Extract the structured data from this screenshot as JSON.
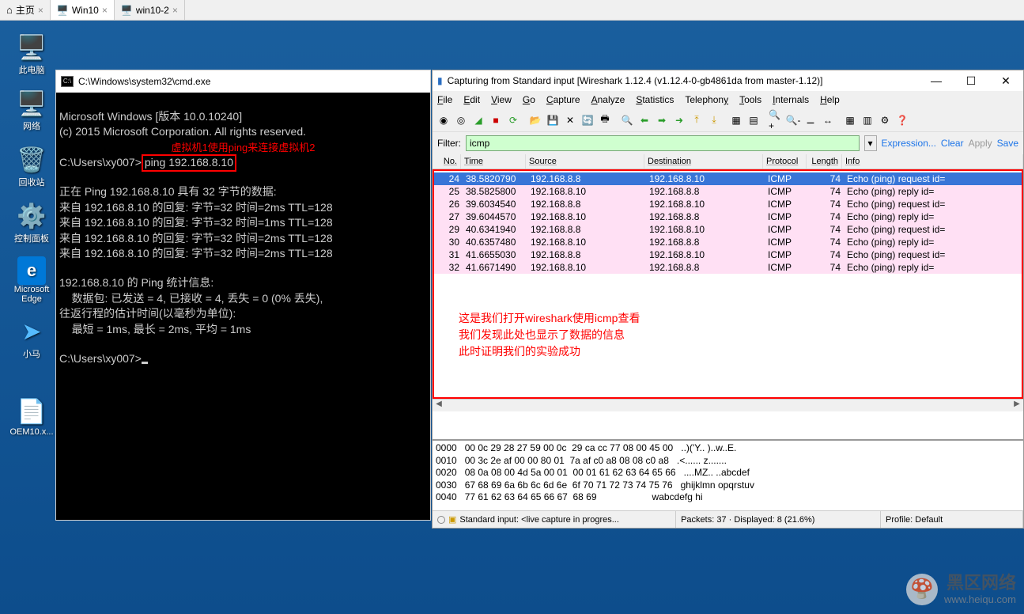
{
  "tabs": {
    "home": "主页",
    "win10": "Win10",
    "win10_2": "win10-2"
  },
  "desktop": [
    {
      "label": "此电脑",
      "icon": "🖥️"
    },
    {
      "label": "网络",
      "icon": "🖥️"
    },
    {
      "label": "回收站",
      "icon": "🗑️"
    },
    {
      "label": "控制面板",
      "icon": "⚙️"
    },
    {
      "label": "Microsoft Edge",
      "icon": "e"
    },
    {
      "label": "小马",
      "icon": "➤"
    },
    {
      "label": "OEM10.x...",
      "icon": "📄"
    }
  ],
  "cmd": {
    "title": "C:\\Windows\\system32\\cmd.exe",
    "line1": "Microsoft Windows [版本 10.0.10240]",
    "line2": "(c) 2015 Microsoft Corporation. All rights reserved.",
    "annotation": "虚拟机1使用ping来连接虚拟机2",
    "prompt1": "C:\\Users\\xy007>",
    "ping_cmd": "ping 192.168.8.10",
    "pinging": "正在 Ping 192.168.8.10 具有 32 字节的数据:",
    "reply1": "来自 192.168.8.10 的回复: 字节=32 时间=2ms TTL=128",
    "reply2": "来自 192.168.8.10 的回复: 字节=32 时间=1ms TTL=128",
    "reply3": "来自 192.168.8.10 的回复: 字节=32 时间=2ms TTL=128",
    "reply4": "来自 192.168.8.10 的回复: 字节=32 时间=2ms TTL=128",
    "stats_hdr": "192.168.8.10 的 Ping 统计信息:",
    "stats_pkts": "    数据包: 已发送 = 4, 已接收 = 4, 丢失 = 0 (0% 丢失),",
    "rtt_hdr": "往返行程的估计时间(以毫秒为单位):",
    "rtt": "    最短 = 1ms, 最长 = 2ms, 平均 = 1ms",
    "prompt2": "C:\\Users\\xy007>"
  },
  "ws": {
    "title": "Capturing from Standard input   [Wireshark 1.12.4  (v1.12.4-0-gb4861da from master-1.12)]",
    "menu": [
      "File",
      "Edit",
      "View",
      "Go",
      "Capture",
      "Analyze",
      "Statistics",
      "Telephony",
      "Tools",
      "Internals",
      "Help"
    ],
    "filter_label": "Filter:",
    "filter_value": "icmp",
    "expression": "Expression...",
    "clear": "Clear",
    "apply": "Apply",
    "save": "Save",
    "columns": [
      "No.",
      "Time",
      "Source",
      "Destination",
      "Protocol",
      "Length",
      "Info"
    ],
    "rows": [
      {
        "no": "24",
        "time": "38.5820790",
        "src": "192.168.8.8",
        "dst": "192.168.8.10",
        "proto": "ICMP",
        "len": "74",
        "info": "Echo (ping) request  id="
      },
      {
        "no": "25",
        "time": "38.5825800",
        "src": "192.168.8.10",
        "dst": "192.168.8.8",
        "proto": "ICMP",
        "len": "74",
        "info": "Echo (ping) reply    id="
      },
      {
        "no": "26",
        "time": "39.6034540",
        "src": "192.168.8.8",
        "dst": "192.168.8.10",
        "proto": "ICMP",
        "len": "74",
        "info": "Echo (ping) request  id="
      },
      {
        "no": "27",
        "time": "39.6044570",
        "src": "192.168.8.10",
        "dst": "192.168.8.8",
        "proto": "ICMP",
        "len": "74",
        "info": "Echo (ping) reply    id="
      },
      {
        "no": "29",
        "time": "40.6341940",
        "src": "192.168.8.8",
        "dst": "192.168.8.10",
        "proto": "ICMP",
        "len": "74",
        "info": "Echo (ping) request  id="
      },
      {
        "no": "30",
        "time": "40.6357480",
        "src": "192.168.8.10",
        "dst": "192.168.8.8",
        "proto": "ICMP",
        "len": "74",
        "info": "Echo (ping) reply    id="
      },
      {
        "no": "31",
        "time": "41.6655030",
        "src": "192.168.8.8",
        "dst": "192.168.8.10",
        "proto": "ICMP",
        "len": "74",
        "info": "Echo (ping) request  id="
      },
      {
        "no": "32",
        "time": "41.6671490",
        "src": "192.168.8.10",
        "dst": "192.168.8.8",
        "proto": "ICMP",
        "len": "74",
        "info": "Echo (ping) reply    id="
      }
    ],
    "annotation": [
      "这是我们打开wireshark使用icmp查看",
      "我们发现此处也显示了数据的信息",
      "此时证明我们的实验成功"
    ],
    "hex": [
      "0000   00 0c 29 28 27 59 00 0c  29 ca cc 77 08 00 45 00   ..)('Y.. )..w..E.",
      "0010   00 3c 2e af 00 00 80 01  7a af c0 a8 08 08 c0 a8   .<...... z.......",
      "0020   08 0a 08 00 4d 5a 00 01  00 01 61 62 63 64 65 66   ....MZ.. ..abcdef",
      "0030   67 68 69 6a 6b 6c 6d 6e  6f 70 71 72 73 74 75 76   ghijklmn opqrstuv",
      "0040   77 61 62 63 64 65 66 67  68 69                     wabcdefg hi"
    ],
    "status_input": "Standard input: <live capture in progres...",
    "status_pkts": "Packets: 37 · Displayed: 8 (21.6%)",
    "status_profile": "Profile: Default"
  },
  "watermark": {
    "title": "黑区网络",
    "url": "www.heiqu.com"
  }
}
